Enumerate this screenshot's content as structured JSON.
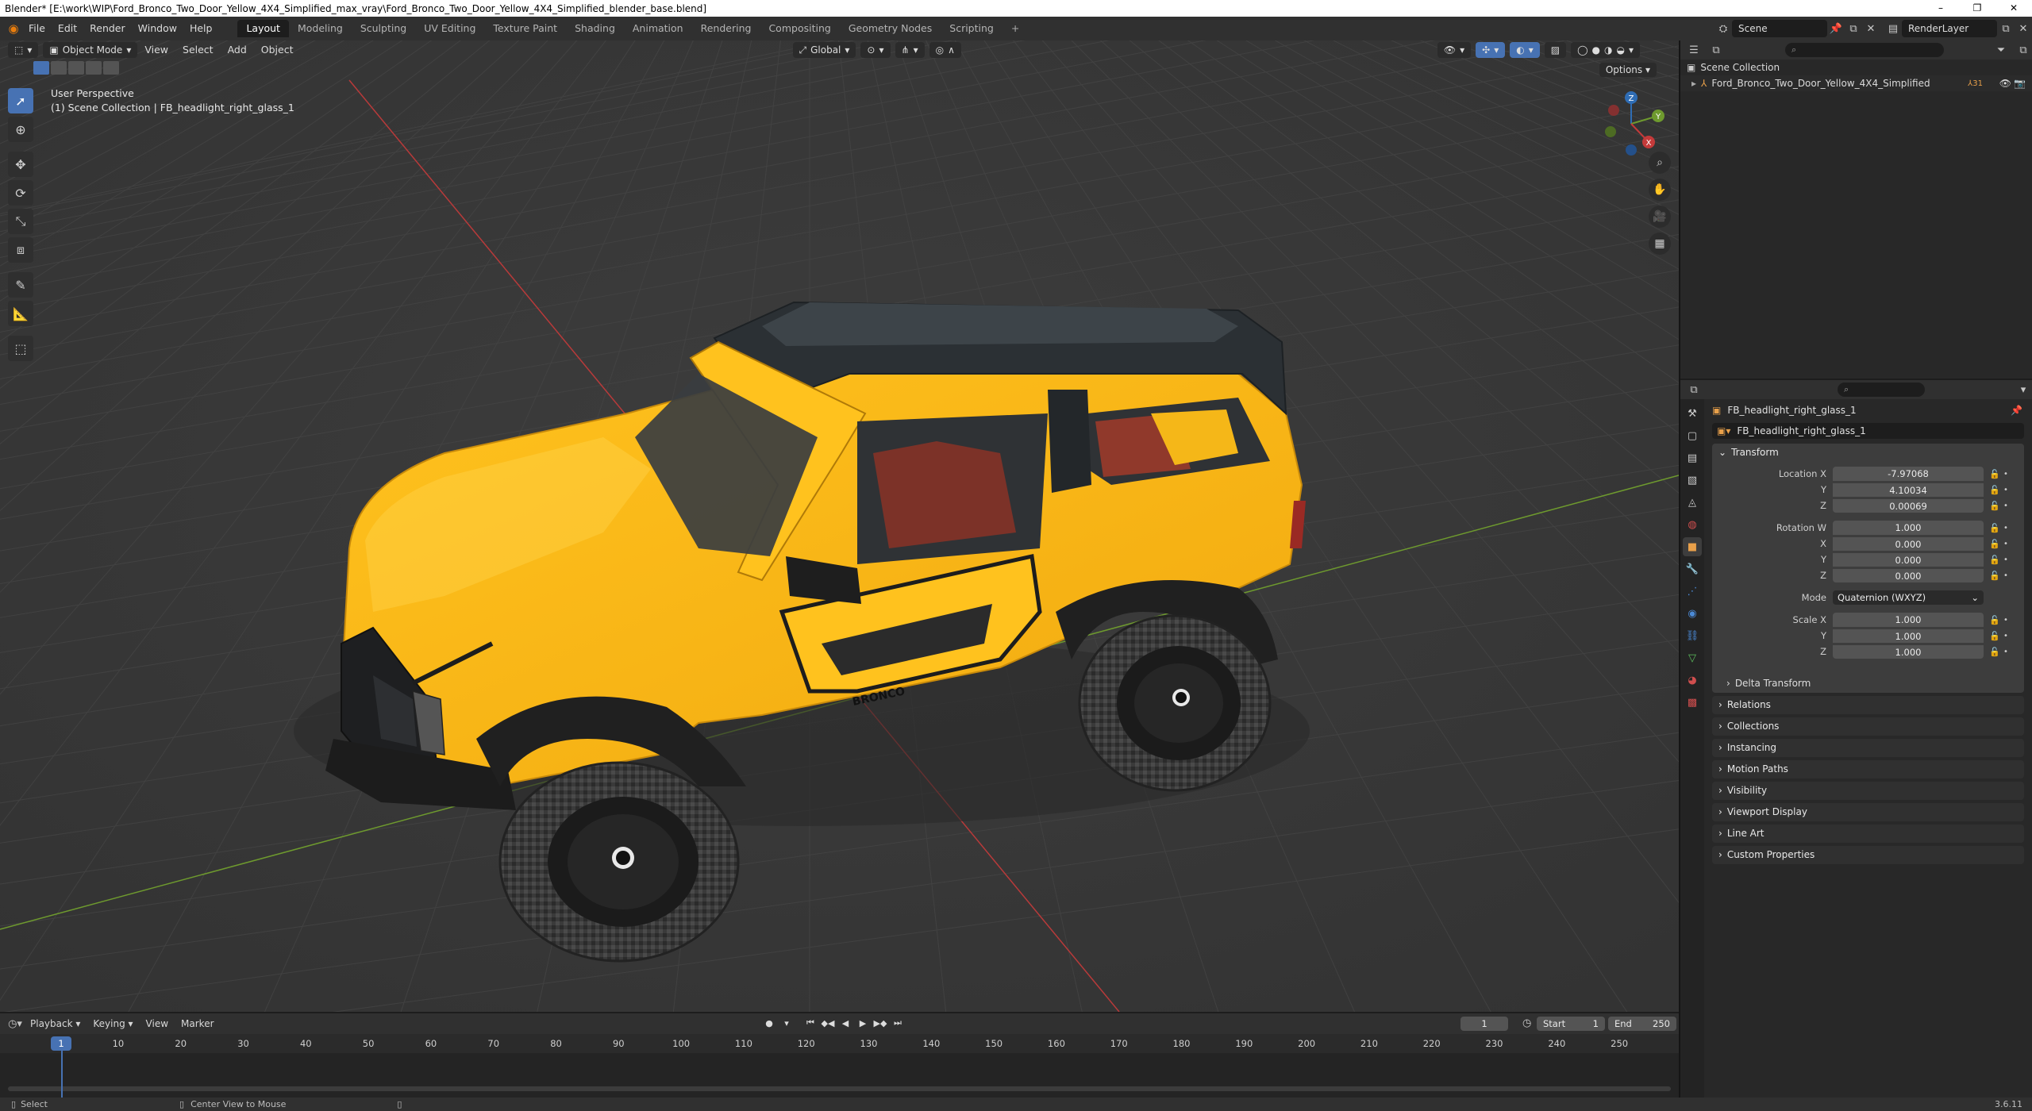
{
  "window": {
    "title": "Blender* [E:\\work\\WIP\\Ford_Bronco_Two_Door_Yellow_4X4_Simplified_max_vray\\Ford_Bronco_Two_Door_Yellow_4X4_Simplified_blender_base.blend]",
    "min": "–",
    "max": "❐",
    "close": "✕"
  },
  "menu": {
    "file": "File",
    "edit": "Edit",
    "render": "Render",
    "window": "Window",
    "help": "Help"
  },
  "workspaces": [
    "Layout",
    "Modeling",
    "Sculpting",
    "UV Editing",
    "Texture Paint",
    "Shading",
    "Animation",
    "Rendering",
    "Compositing",
    "Geometry Nodes",
    "Scripting"
  ],
  "workspace_add": "+",
  "scene": {
    "label": "Scene",
    "render_layer": "RenderLayer"
  },
  "viewport": {
    "mode": "Object Mode",
    "view": "View",
    "select": "Select",
    "add": "Add",
    "object": "Object",
    "orientation": "Global",
    "options": "Options",
    "info_line1": "User Perspective",
    "info_line2": "(1) Scene Collection | FB_headlight_right_glass_1",
    "gizmo": {
      "x": "X",
      "y": "Y",
      "z": "Z"
    },
    "body_text": "BRONCO"
  },
  "outliner": {
    "root": "Scene Collection",
    "object": "Ford_Bronco_Two_Door_Yellow_4X4_Simplified",
    "object_count": "31"
  },
  "properties": {
    "object_name": "FB_headlight_right_glass_1",
    "data_name": "FB_headlight_right_glass_1",
    "transform_title": "Transform",
    "location": {
      "label": "Location X",
      "x": "-7.97068",
      "y": "4.10034",
      "z": "0.00069"
    },
    "rotation": {
      "label": "Rotation W",
      "w": "1.000",
      "x": "0.000",
      "y": "0.000",
      "z": "0.000"
    },
    "mode": {
      "label": "Mode",
      "value": "Quaternion (WXYZ)"
    },
    "scale": {
      "label": "Scale X",
      "x": "1.000",
      "y": "1.000",
      "z": "1.000"
    },
    "axis_labels": {
      "x": "X",
      "y": "Y",
      "z": "Z"
    },
    "delta_transform": "Delta Transform",
    "panels": [
      "Relations",
      "Collections",
      "Instancing",
      "Motion Paths",
      "Visibility",
      "Viewport Display",
      "Line Art",
      "Custom Properties"
    ]
  },
  "timeline": {
    "playback": "Playback",
    "keying": "Keying",
    "view": "View",
    "marker": "Marker",
    "current_frame": "1",
    "start_label": "Start",
    "start": "1",
    "end_label": "End",
    "end": "250",
    "ticks": [
      "10",
      "20",
      "30",
      "40",
      "50",
      "60",
      "70",
      "80",
      "90",
      "100",
      "110",
      "120",
      "130",
      "140",
      "150",
      "160",
      "170",
      "180",
      "190",
      "200",
      "210",
      "220",
      "230",
      "240",
      "250"
    ]
  },
  "statusbar": {
    "select": "Select",
    "center": "Center View to Mouse",
    "version": "3.6.11"
  }
}
